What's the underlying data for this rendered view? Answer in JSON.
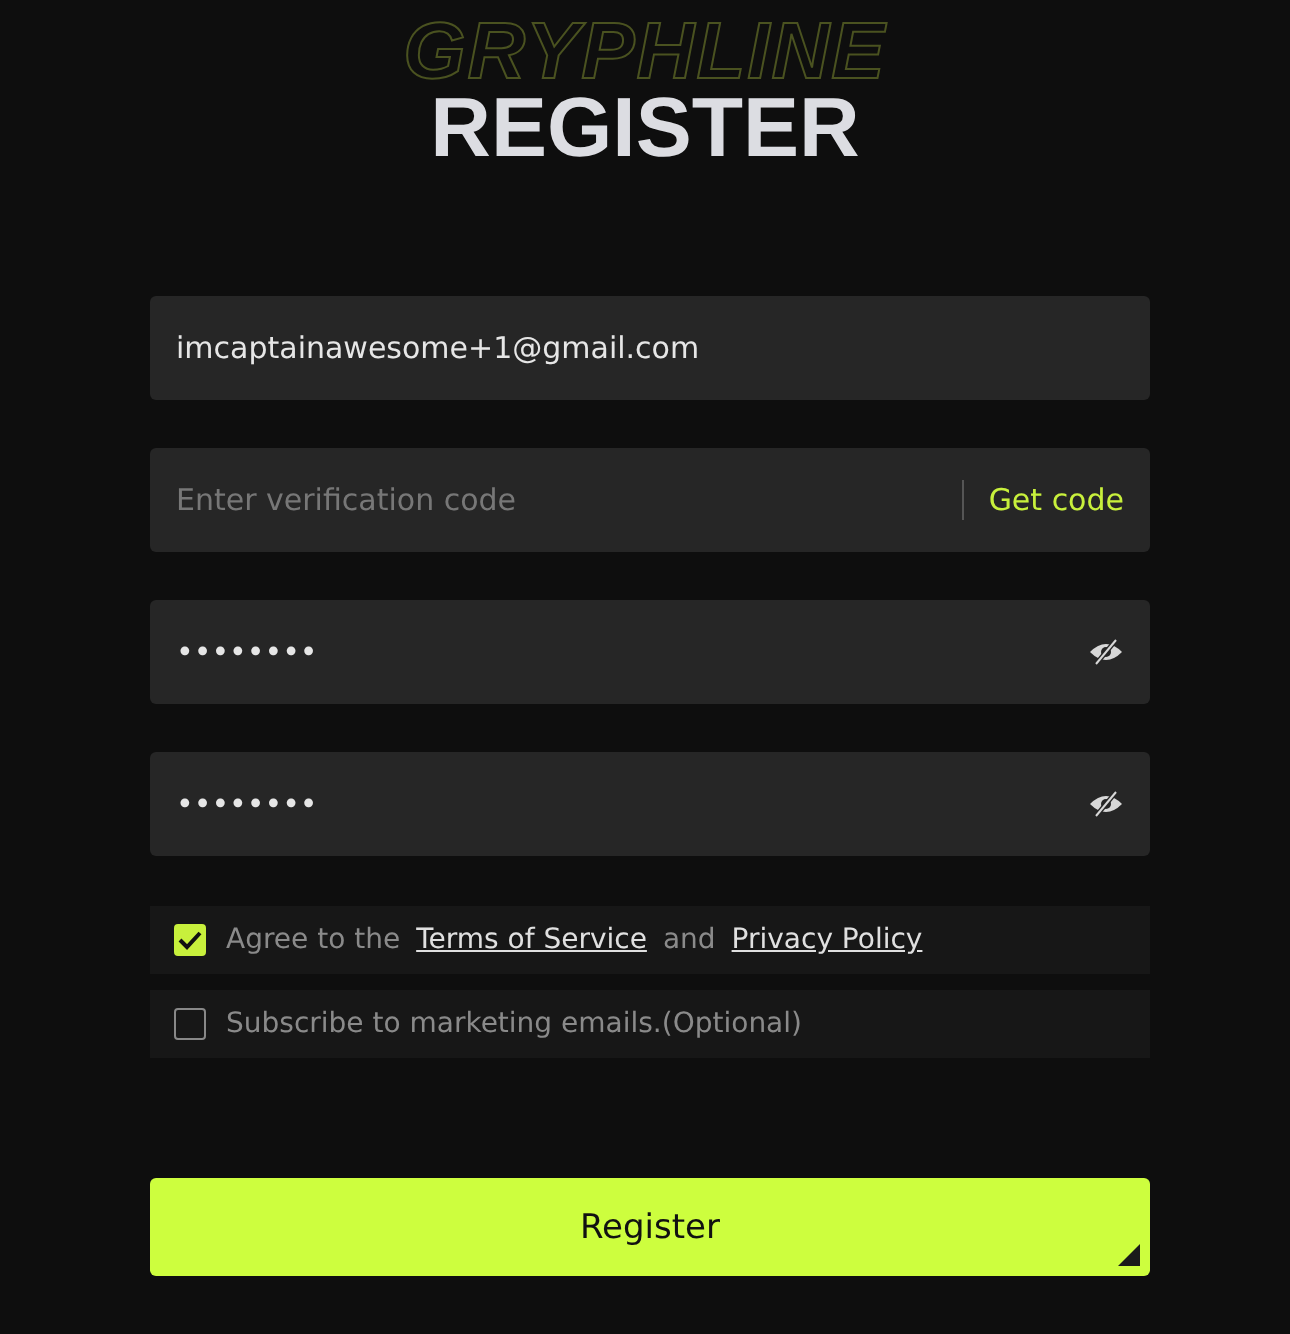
{
  "logo": "GRYPHLINE",
  "title": "REGISTER",
  "fields": [
    {
      "kind": "text",
      "value": "imcaptainawesome+1@gmail.com"
    },
    {
      "kind": "code",
      "placeholder": "Enter verification code",
      "action": "Get code"
    },
    {
      "kind": "password",
      "value": "••••••••"
    },
    {
      "kind": "password",
      "value": "••••••••"
    }
  ],
  "checkboxes": [
    {
      "kind": "terms",
      "checked": true,
      "parts": [
        "Agree to the",
        "Terms of Service",
        "and",
        "Privacy Policy"
      ]
    },
    {
      "kind": "plain",
      "checked": false,
      "parts": [
        "Subscribe to marketing emails.(Optional)"
      ]
    }
  ],
  "submit": "Register"
}
